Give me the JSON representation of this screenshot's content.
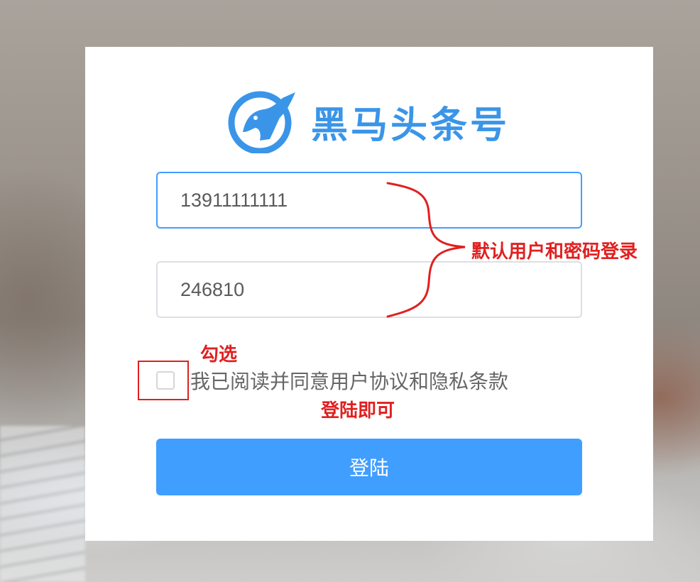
{
  "app": {
    "brand_name": "黑马头条号",
    "logo_icon": "horse-logo-icon",
    "brand_color": "#3a95e8"
  },
  "login_form": {
    "phone_value": "13911111111",
    "password_value": "246810",
    "agreement_label": "我已阅读并同意用户协议和隐私条款",
    "agreement_checked": false,
    "submit_label": "登陆",
    "accent_color": "#409eff"
  },
  "annotations": {
    "default_credentials": "默认用户和密码登录",
    "check_hint": "勾选",
    "login_hint": "登陆即可",
    "color": "#e02020"
  }
}
